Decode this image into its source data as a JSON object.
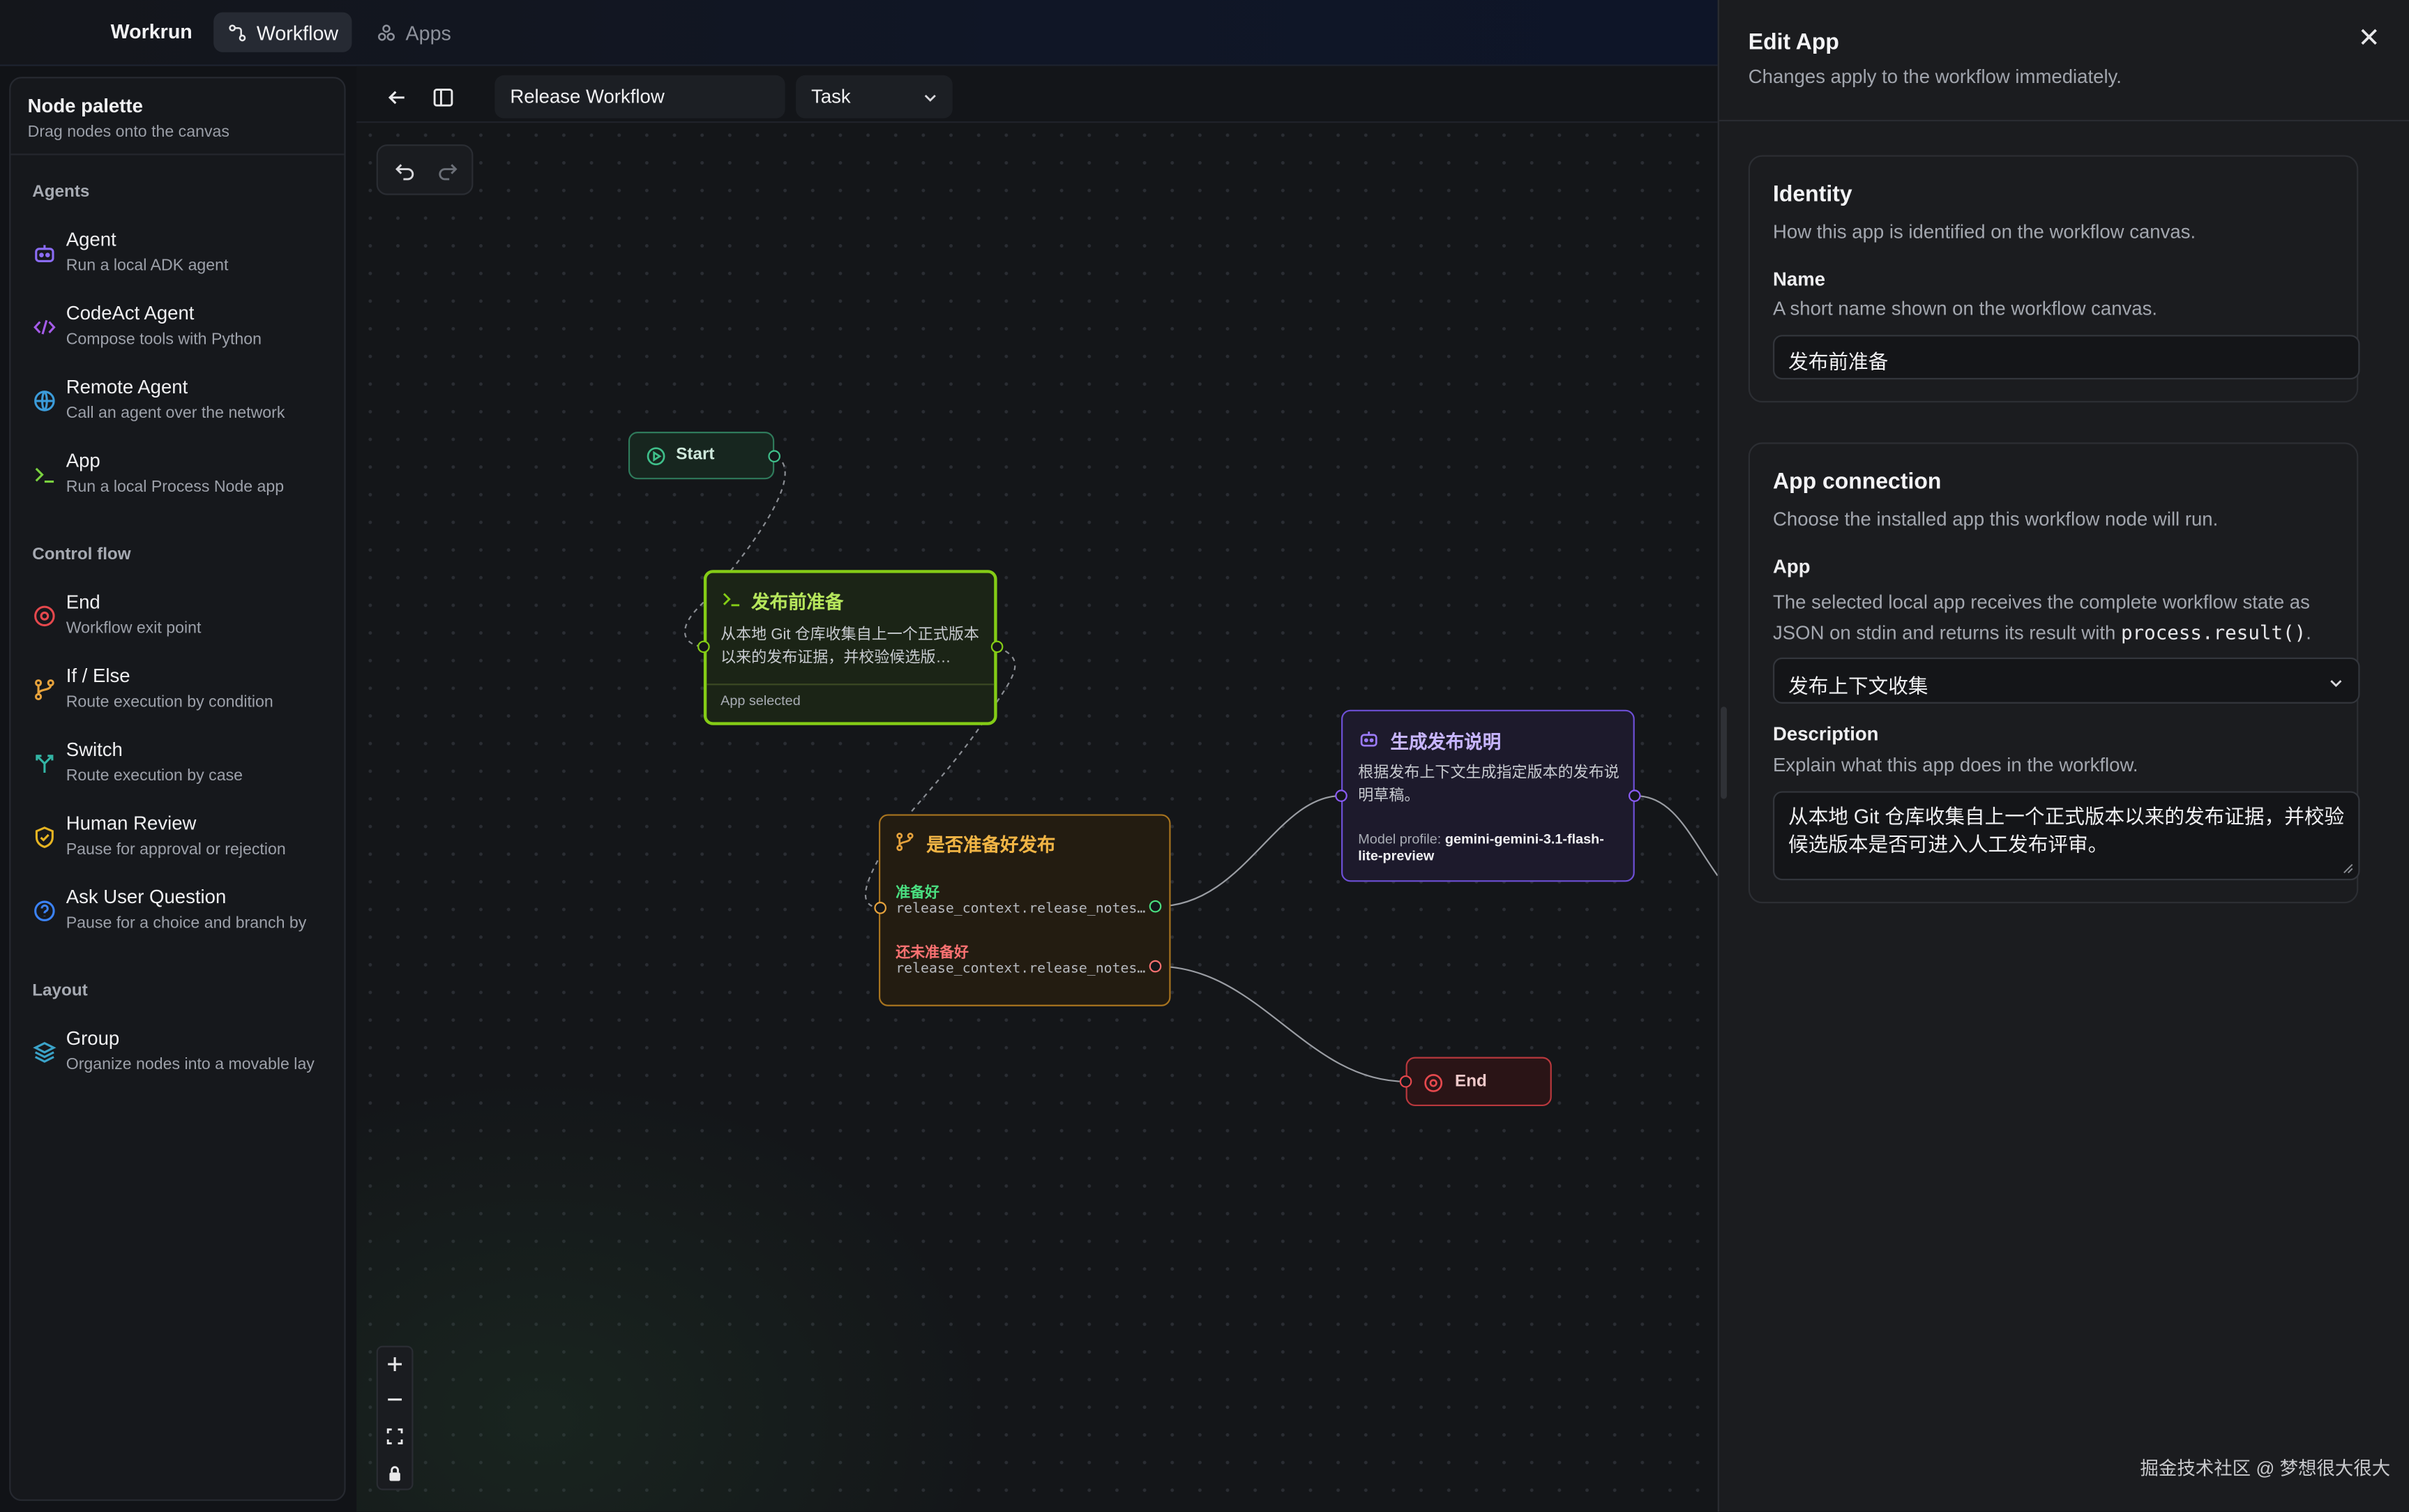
{
  "topbar": {
    "brand": "Workrun",
    "tabs": [
      {
        "label": "Workflow",
        "icon": "workflow-icon",
        "active": true
      },
      {
        "label": "Apps",
        "icon": "apps-icon",
        "active": false
      }
    ]
  },
  "palette": {
    "title": "Node palette",
    "subtitle": "Drag nodes onto the canvas",
    "groups": [
      {
        "label": "Agents",
        "items": [
          {
            "name": "Agent",
            "desc": "Run a local ADK agent",
            "icon": "robot-icon",
            "color": "#8b6cf6"
          },
          {
            "name": "CodeAct Agent",
            "desc": "Compose tools with Python",
            "icon": "code-icon",
            "color": "#a45be8"
          },
          {
            "name": "Remote Agent",
            "desc": "Call an agent over the network",
            "icon": "globe-icon",
            "color": "#3b9bd9"
          },
          {
            "name": "App",
            "desc": "Run a local Process Node app",
            "icon": "terminal-icon",
            "color": "#7ad13f"
          }
        ]
      },
      {
        "label": "Control flow",
        "items": [
          {
            "name": "End",
            "desc": "Workflow exit point",
            "icon": "stop-circle-icon",
            "color": "#e5484d"
          },
          {
            "name": "If / Else",
            "desc": "Route execution by condition",
            "icon": "branch-icon",
            "color": "#e6a23c"
          },
          {
            "name": "Switch",
            "desc": "Route execution by case",
            "icon": "switch-icon",
            "color": "#33b5a5"
          },
          {
            "name": "Human Review",
            "desc": "Pause for approval or rejection",
            "icon": "shield-check-icon",
            "color": "#e6b422"
          },
          {
            "name": "Ask User Question",
            "desc": "Pause for a choice and branch by",
            "icon": "question-circle-icon",
            "color": "#3b82f6"
          }
        ]
      },
      {
        "label": "Layout",
        "items": [
          {
            "name": "Group",
            "desc": "Organize nodes into a movable lay",
            "icon": "layers-icon",
            "color": "#3ba3c9"
          }
        ]
      }
    ]
  },
  "toolbar": {
    "back_icon": "arrow-left-icon",
    "sidebar_icon": "sidebar-toggle-icon",
    "workflow_name": "Release Workflow",
    "workflow_type": "Task",
    "undo_icon": "undo-icon",
    "redo_icon": "redo-icon"
  },
  "zoom_controls": [
    "zoom-in-icon",
    "zoom-out-icon",
    "fit-view-icon",
    "lock-icon"
  ],
  "nodes": {
    "start": {
      "label": "Start",
      "color": "#3fbf8a"
    },
    "app": {
      "title": "发布前准备",
      "desc": "从本地 Git 仓库收集自上一个正式版本以来的发布证据，并校验候选版…",
      "footer": "App selected",
      "color": "#84cc16"
    },
    "ifelse": {
      "title": "是否准备好发布",
      "branches": [
        {
          "label": "准备好",
          "expr": "release_context.release_notes…",
          "color": "#4ade80"
        },
        {
          "label": "还未准备好",
          "expr": "release_context.release_notes…",
          "color": "#f87171"
        }
      ],
      "color": "#d99a2b"
    },
    "agent": {
      "title": "生成发布说明",
      "desc": "根据发布上下文生成指定版本的发布说明草稿。",
      "profile_label": "Model profile:",
      "profile_value": "gemini-gemini-3.1-flash-lite-preview",
      "color": "#8b5cf6"
    },
    "end": {
      "label": "End",
      "color": "#e5484d"
    }
  },
  "panel": {
    "title": "Edit App",
    "subtitle": "Changes apply to the workflow immediately.",
    "identity": {
      "title": "Identity",
      "subtitle": "How this app is identified on the workflow canvas.",
      "name_label": "Name",
      "name_hint": "A short name shown on the workflow canvas.",
      "name_value": "发布前准备"
    },
    "connection": {
      "title": "App connection",
      "subtitle": "Choose the installed app this workflow node will run.",
      "app_label": "App",
      "app_hint_a": "The selected local app receives the complete workflow state as",
      "app_hint_b": "JSON on stdin and returns its result with",
      "app_hint_code": "process.result()",
      "app_hint_end": ".",
      "app_value": "发布上下文收集",
      "desc_label": "Description",
      "desc_hint": "Explain what this app does in the workflow.",
      "desc_value": "从本地 Git 仓库收集自上一个正式版本以来的发布证据，并校验候选版本是否可进入人工发布评审。"
    }
  },
  "watermark": "掘金技术社区 @ 梦想很大很大"
}
